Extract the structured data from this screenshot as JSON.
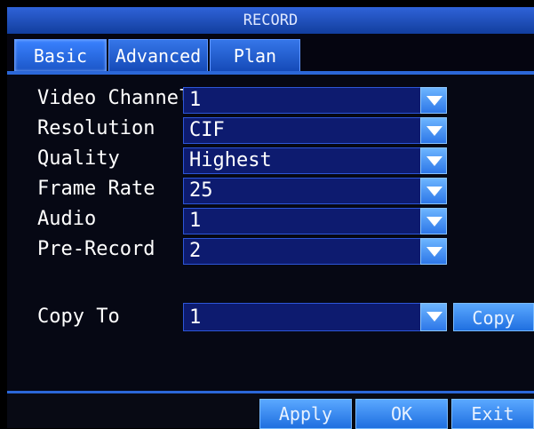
{
  "window": {
    "title": "RECORD"
  },
  "tabs": [
    {
      "label": "Basic"
    },
    {
      "label": "Advanced"
    },
    {
      "label": "Plan"
    }
  ],
  "fields": [
    {
      "label": "Video Channel",
      "value": "1"
    },
    {
      "label": "Resolution",
      "value": "CIF"
    },
    {
      "label": "Quality",
      "value": "Highest"
    },
    {
      "label": "Frame Rate",
      "value": "25"
    },
    {
      "label": "Audio",
      "value": "1"
    },
    {
      "label": "Pre-Record",
      "value": "2"
    }
  ],
  "copy": {
    "label": "Copy To",
    "value": "1",
    "button": "Copy"
  },
  "footer": {
    "apply": "Apply",
    "ok": "OK",
    "exit": "Exit"
  },
  "colors": {
    "accent": "#2b67d8",
    "field_bg": "#0d1b6f",
    "button": "#3a8cff"
  },
  "icons": {
    "dropdown": "chevron-down-icon"
  }
}
